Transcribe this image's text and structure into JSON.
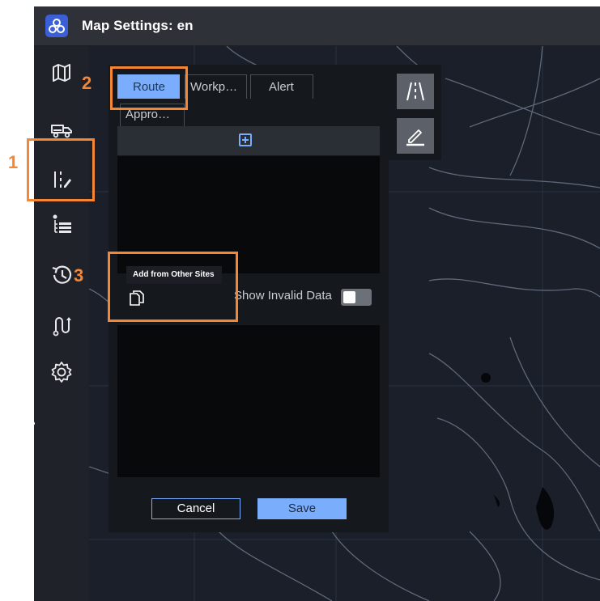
{
  "app": {
    "title": "Map Settings: en"
  },
  "sidebar": {
    "items": [
      {
        "name": "map-icon"
      },
      {
        "name": "truck-icon"
      },
      {
        "name": "road-edit-icon"
      },
      {
        "name": "list-icon"
      },
      {
        "name": "history-icon"
      },
      {
        "name": "route-icon"
      },
      {
        "name": "settings-icon"
      }
    ]
  },
  "panel": {
    "tabs": [
      "Route",
      "Workp…",
      "Alert",
      "Appro…"
    ],
    "active_tab": "Route",
    "tooltip": "Add from Other Sites",
    "show_invalid_label": "Show Invalid Data",
    "show_invalid_value": false,
    "cancel_label": "Cancel",
    "save_label": "Save"
  },
  "tools": [
    {
      "name": "road-lanes-icon"
    },
    {
      "name": "edit-icon"
    }
  ],
  "annotations": {
    "labels": [
      "1",
      "2",
      "3"
    ],
    "color": "#f58634"
  },
  "colors": {
    "accent": "#7aaefc",
    "panel_bg": "#15181d",
    "map_bg": "#1a1f29"
  }
}
